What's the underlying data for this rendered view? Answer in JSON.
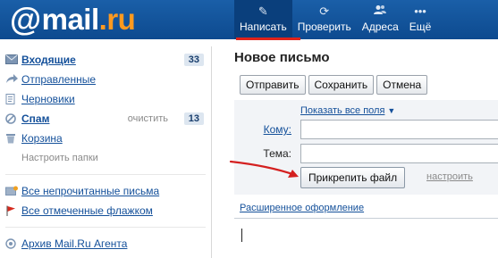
{
  "header": {
    "logo_mail": "mail",
    "logo_dot": ".",
    "logo_ru": "ru",
    "nav": [
      {
        "label": "Написать",
        "icon": "pencil-icon",
        "glyph": "✎",
        "active": true
      },
      {
        "label": "Проверить",
        "icon": "refresh-icon",
        "glyph": "⟳",
        "active": false
      },
      {
        "label": "Адреса",
        "icon": "contacts-icon",
        "glyph": "👥",
        "active": false
      },
      {
        "label": "Ещё",
        "icon": "more-icon",
        "glyph": "•••",
        "active": false
      }
    ]
  },
  "sidebar": {
    "folders": [
      {
        "label": "Входящие",
        "count": "33",
        "icon": "envelope-icon"
      },
      {
        "label": "Отправленные",
        "icon": "sent-arrow-icon"
      },
      {
        "label": "Черновики",
        "icon": "drafts-icon"
      },
      {
        "label": "Спам",
        "count": "13",
        "clear": "очистить",
        "icon": "spam-icon"
      },
      {
        "label": "Корзина",
        "icon": "trash-icon"
      }
    ],
    "settings_link": "Настроить папки",
    "filters": [
      {
        "label": "Все непрочитанные письма",
        "icon": "unread-icon"
      },
      {
        "label": "Все отмеченные флажком",
        "icon": "flag-icon"
      }
    ],
    "archive": {
      "label": "Архив Mail.Ru Агента",
      "icon": "agent-icon"
    }
  },
  "compose": {
    "title": "Новое письмо",
    "buttons": {
      "send": "Отправить",
      "save": "Сохранить",
      "cancel": "Отмена"
    },
    "show_all_fields": "Показать все поля",
    "to_label": "Кому:",
    "subject_label": "Тема:",
    "to_value": "",
    "subject_value": "",
    "attach_button": "Прикрепить файл",
    "configure_link": "настроить",
    "advanced_format": "Расширенное оформление"
  },
  "colors": {
    "header_bg": "#1a5fa8",
    "accent_orange": "#ff9a1f",
    "active_underline": "#e0231a",
    "link": "#14509a",
    "arrow": "#d42020"
  }
}
